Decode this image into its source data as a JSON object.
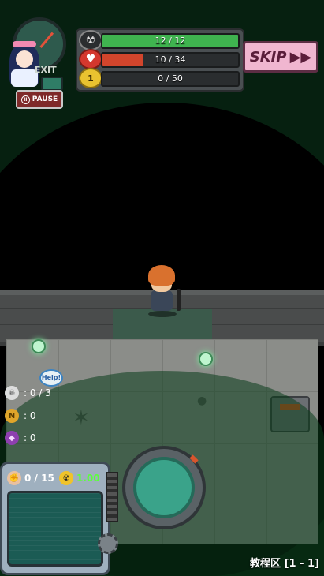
{
  "hud": {
    "exit_label": "EXIT",
    "pause_label": "PAUSE",
    "skip_label": "SKIP",
    "skip_arrows": "▶▶",
    "mask_value": 12,
    "mask_max": 12,
    "mask_text": "12 / 12",
    "health_value": 10,
    "health_max": 34,
    "health_text": "10 / 34",
    "level": "1",
    "xp_value": 0,
    "xp_max": 50,
    "xp_text": "0 / 50",
    "colors": {
      "mask_bar": "#3fb34f",
      "health_bar": "#d2452c",
      "xp_bar": "#7a7f82",
      "skip_bg": "#f0b6d0"
    }
  },
  "stats": {
    "help_text": "Help!",
    "survivors": ": 0 / 3",
    "coins": ": 0",
    "gems": ": 0"
  },
  "panel": {
    "strength": "0 / 15",
    "radiation": "1.00"
  },
  "footer": {
    "area_label": "教程区 [1 - 1]"
  }
}
